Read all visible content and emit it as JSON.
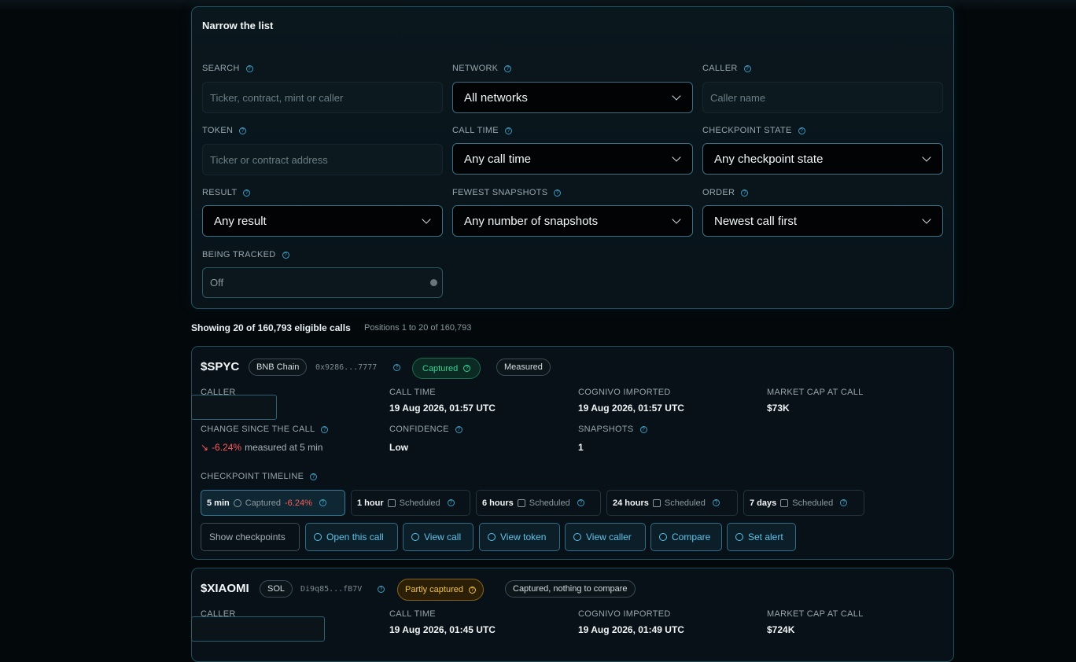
{
  "filters": {
    "title": "Narrow the list",
    "search": {
      "label": "SEARCH",
      "placeholder": "Ticker, contract, mint or caller"
    },
    "network": {
      "label": "NETWORK",
      "value": "All networks"
    },
    "caller": {
      "label": "CALLER",
      "placeholder": "Caller name"
    },
    "token": {
      "label": "TOKEN",
      "placeholder": "Ticker or contract address"
    },
    "call_time": {
      "label": "CALL TIME",
      "value": "Any call time"
    },
    "checkpoint_state": {
      "label": "CHECKPOINT STATE",
      "value": "Any checkpoint state"
    },
    "result": {
      "label": "RESULT",
      "value": "Any result"
    },
    "fewest_snapshots": {
      "label": "FEWEST SNAPSHOTS",
      "value": "Any number of snapshots"
    },
    "order": {
      "label": "ORDER",
      "value": "Newest call first"
    },
    "being_tracked": {
      "label": "BEING TRACKED",
      "value": "Off"
    }
  },
  "summary": {
    "showing": "Showing 20 of 160,793 eligible calls",
    "positions": "Positions 1 to 20 of 160,793"
  },
  "calls": [
    {
      "ticker": "$SPYC",
      "network": "BNB Chain",
      "address": "0x9286...7777",
      "state": "Captured",
      "result_badge": "Measured",
      "labels": {
        "caller": "CALLER",
        "call_time": "CALL TIME",
        "imported": "COGNIVO IMPORTED",
        "mcap": "MARKET CAP AT CALL",
        "change": "CHANGE SINCE THE CALL",
        "confidence": "CONFIDENCE",
        "snapshots": "SNAPSHOTS",
        "timeline": "CHECKPOINT TIMELINE"
      },
      "call_time": "19 Aug 2026, 01:57 UTC",
      "imported": "19 Aug 2026, 01:57 UTC",
      "mcap": "$73K",
      "change_arrow": "↘",
      "change": "-6.24%",
      "change_note": "measured at 5 min",
      "confidence": "Low",
      "snapshots": "1",
      "checkpoints": [
        {
          "label": "5 min",
          "status": "Captured",
          "delta": "-6.24%"
        },
        {
          "label": "1 hour",
          "status": "Scheduled"
        },
        {
          "label": "6 hours",
          "status": "Scheduled"
        },
        {
          "label": "24 hours",
          "status": "Scheduled"
        },
        {
          "label": "7 days",
          "status": "Scheduled"
        }
      ],
      "actions": {
        "show": "Show checkpoints",
        "open": "Open this call",
        "view_call": "View call",
        "view_token": "View token",
        "view_caller": "View caller",
        "compare": "Compare",
        "alert": "Set alert"
      }
    },
    {
      "ticker": "$XIAOMI",
      "network": "SOL",
      "address": "Di9q85...fB7V",
      "state": "Partly captured",
      "result_badge": "Captured, nothing to compare",
      "labels": {
        "caller": "CALLER",
        "call_time": "CALL TIME",
        "imported": "COGNIVO IMPORTED",
        "mcap": "MARKET CAP AT CALL"
      },
      "call_time": "19 Aug 2026, 01:45 UTC",
      "imported": "19 Aug 2026, 01:49 UTC",
      "mcap": "$724K"
    }
  ],
  "colors": {
    "accent": "#5fc4ec",
    "captured": "#35d198",
    "partial": "#f2c13e",
    "negative": "#ff5a5a"
  }
}
